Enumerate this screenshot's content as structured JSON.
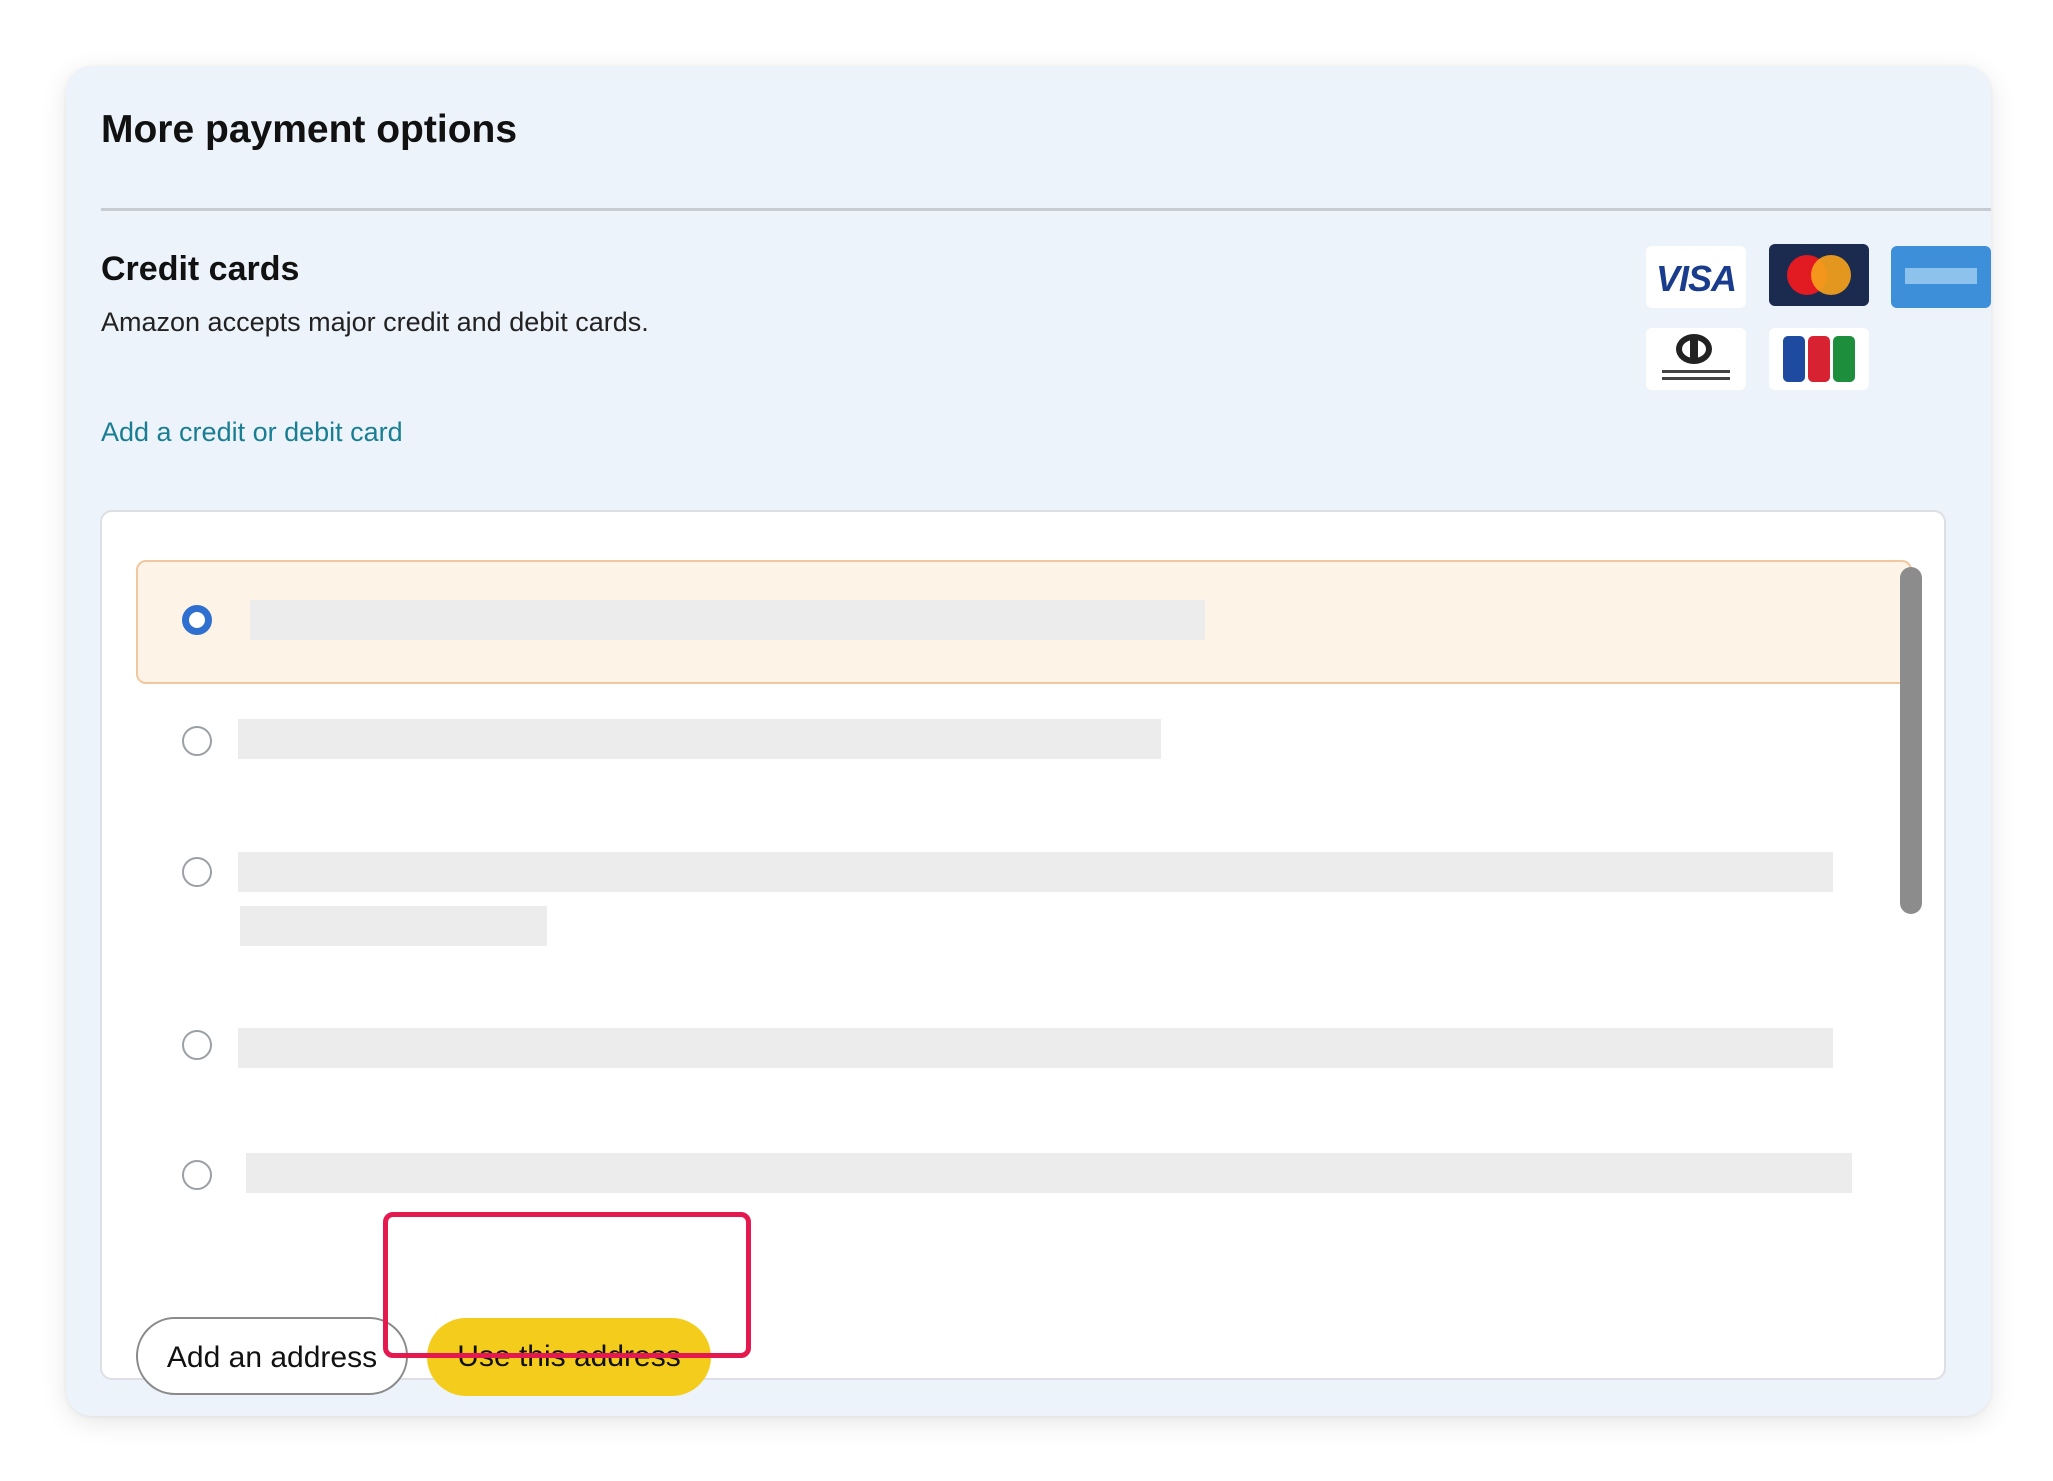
{
  "header": {
    "title": "More payment options"
  },
  "credit_cards": {
    "title": "Credit cards",
    "description": "Amazon accepts major credit and debit cards.",
    "add_link": "Add a credit or debit card",
    "logos": [
      {
        "name": "visa-logo",
        "label": "VISA"
      },
      {
        "name": "mastercard-logo"
      },
      {
        "name": "amex-logo"
      },
      {
        "name": "diners-club-logo"
      },
      {
        "name": "jcb-logo"
      }
    ]
  },
  "address_list": {
    "options": [
      {
        "selected": true
      },
      {
        "selected": false
      },
      {
        "selected": false
      },
      {
        "selected": false
      },
      {
        "selected": false
      }
    ]
  },
  "actions": {
    "add_address_label": "Add an address",
    "use_address_label": "Use this address"
  },
  "colors": {
    "card_background": "#edf3fa",
    "selected_background": "#fdf3e7",
    "link": "#1a7e93",
    "primary_button": "#f4cd1c",
    "radio_selected": "#2f6fd0",
    "highlight": "#e3194f"
  }
}
